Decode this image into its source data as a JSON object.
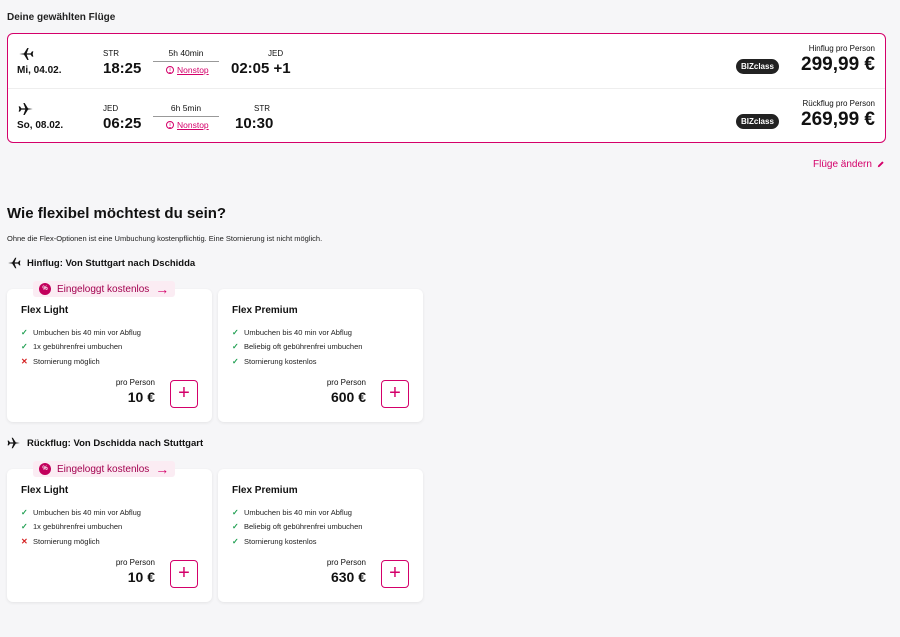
{
  "selected_flights": {
    "title": "Deine gewählten Flüge",
    "outbound": {
      "date": "Mi, 04.02.",
      "from_code": "STR",
      "dep_time": "18:25",
      "duration": "5h 40min",
      "stop": "Nonstop",
      "to_code": "JED",
      "arr_time": "02:05 +1",
      "fare_badge": "BIZclass",
      "price_label": "Hinflug pro Person",
      "price": "299,99 €"
    },
    "return": {
      "date": "So, 08.02.",
      "from_code": "JED",
      "dep_time": "06:25",
      "duration": "6h 5min",
      "stop": "Nonstop",
      "to_code": "STR",
      "arr_time": "10:30",
      "fare_badge": "BIZclass",
      "price_label": "Rückflug pro Person",
      "price": "269,99 €"
    },
    "change_link": "Flüge ändern"
  },
  "flex": {
    "heading": "Wie flexibel möchtest du sein?",
    "subtext": "Ohne die Flex-Optionen ist eine Umbuchung kostenpflichtig. Eine Stornierung ist nicht möglich.",
    "legs": [
      {
        "title": "Hinflug: Von Stuttgart nach Dschidda",
        "promo": "Eingeloggt kostenlos",
        "light": {
          "name": "Flex Light",
          "features": [
            "Umbuchen bis 40 min vor Abflug",
            "1x gebührenfrei umbuchen",
            "Stornierung möglich"
          ],
          "per_person": "pro Person",
          "price": "10 €"
        },
        "premium": {
          "name": "Flex Premium",
          "features": [
            "Umbuchen bis 40 min vor Abflug",
            "Beliebig oft gebührenfrei umbuchen",
            "Stornierung kostenlos"
          ],
          "per_person": "pro Person",
          "price": "600 €"
        }
      },
      {
        "title": "Rückflug: Von Dschidda nach Stuttgart",
        "promo": "Eingeloggt kostenlos",
        "light": {
          "name": "Flex Light",
          "features": [
            "Umbuchen bis 40 min vor Abflug",
            "1x gebührenfrei umbuchen",
            "Stornierung möglich"
          ],
          "per_person": "pro Person",
          "price": "10 €"
        },
        "premium": {
          "name": "Flex Premium",
          "features": [
            "Umbuchen bis 40 min vor Abflug",
            "Beliebig oft gebührenfrei umbuchen",
            "Stornierung kostenlos"
          ],
          "per_person": "pro Person",
          "price": "630 €"
        }
      }
    ]
  },
  "colors": {
    "accent": "#d4006a",
    "check": "#1e9e50",
    "cross": "#d42020"
  },
  "icons": [
    "plane-takeoff-icon",
    "plane-landing-icon",
    "info-icon",
    "pencil-icon",
    "percent-icon",
    "arrow-right-icon",
    "check-icon",
    "cross-icon",
    "plus-icon"
  ]
}
